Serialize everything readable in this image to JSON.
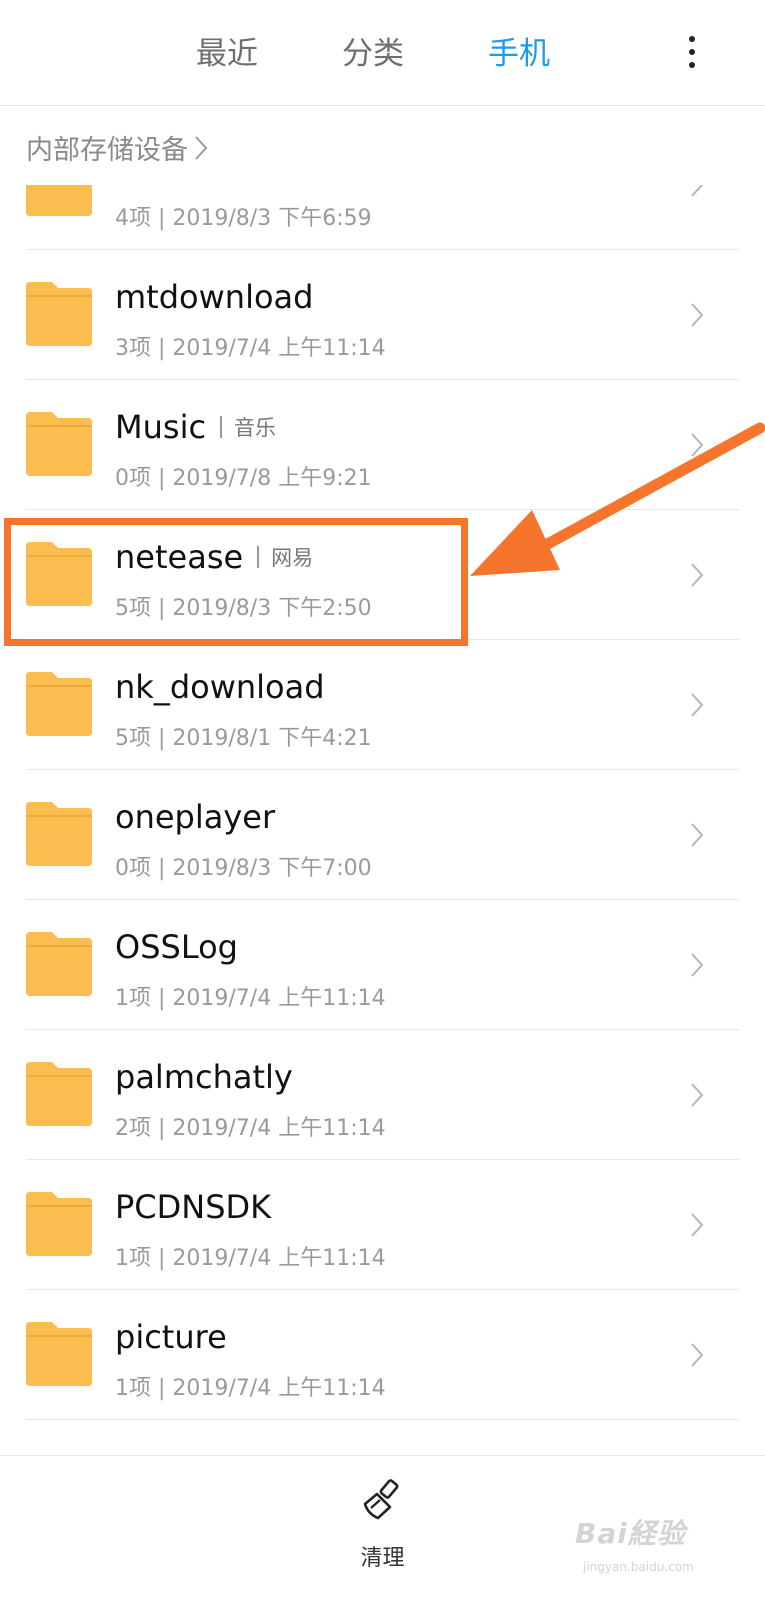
{
  "header": {
    "tabs": [
      {
        "label": "最近",
        "active": false
      },
      {
        "label": "分类",
        "active": false
      },
      {
        "label": "手机",
        "active": true
      }
    ],
    "more_icon": "vertical-ellipsis-icon",
    "accent_color": "#1e9be8"
  },
  "breadcrumb": {
    "label": "内部存储设备",
    "icon": "chevron-right-icon"
  },
  "folders": [
    {
      "name": "",
      "alias": "",
      "meta": "4项 | 2019/8/3 下午6:59"
    },
    {
      "name": "mtdownload",
      "alias": "",
      "meta": "3项 | 2019/7/4 上午11:14"
    },
    {
      "name": "Music",
      "alias": "音乐",
      "meta": "0项 | 2019/7/8 上午9:21"
    },
    {
      "name": "netease",
      "alias": "网易",
      "meta": "5项 | 2019/8/3 下午2:50"
    },
    {
      "name": "nk_download",
      "alias": "",
      "meta": "5项 | 2019/8/1 下午4:21"
    },
    {
      "name": "oneplayer",
      "alias": "",
      "meta": "0项 | 2019/8/3 下午7:00"
    },
    {
      "name": "OSSLog",
      "alias": "",
      "meta": "1项 | 2019/7/4 上午11:14"
    },
    {
      "name": "palmchatly",
      "alias": "",
      "meta": "2项 | 2019/7/4 上午11:14"
    },
    {
      "name": "PCDNSDK",
      "alias": "",
      "meta": "1项 | 2019/7/4 上午11:14"
    },
    {
      "name": "picture",
      "alias": "",
      "meta": "1项 | 2019/7/4 上午11:14"
    }
  ],
  "folder_color": "#fbbd4f",
  "annotation": {
    "color": "#f5752d",
    "highlighted_folder": "netease"
  },
  "bottom": {
    "clean_label": "清理",
    "clean_icon": "broom-icon"
  },
  "watermark": {
    "logo": "Bai経验",
    "url": "jingyan.baidu.com"
  }
}
